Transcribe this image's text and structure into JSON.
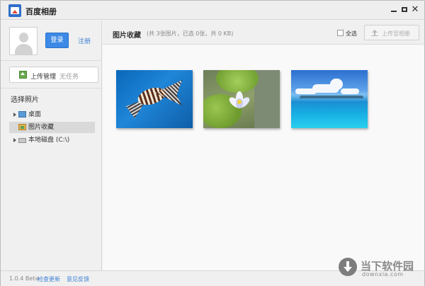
{
  "window": {
    "title": "百度相册"
  },
  "account": {
    "login_label": "登录",
    "register_label": "注册"
  },
  "upload_manager": {
    "label": "上传管理",
    "status": "无任务"
  },
  "sidebar": {
    "section_title": "选择照片",
    "tree": [
      {
        "label": "桌面",
        "icon": "desktop-icon",
        "selected": false,
        "expandable": true
      },
      {
        "label": "图片收藏",
        "icon": "photos-folder-icon",
        "selected": true,
        "expandable": false
      },
      {
        "label": "本地磁盘 (C:\\)",
        "icon": "disk-icon",
        "selected": false,
        "expandable": true
      }
    ]
  },
  "main": {
    "title": "图片收藏",
    "stats": "(共 3张图片，已选 0张，共 0 KB)",
    "select_all_label": "全选",
    "upload_button_label": "上传至相册",
    "photos": [
      {
        "name": "lionfish-photo"
      },
      {
        "name": "water-lily-photo"
      },
      {
        "name": "sea-photo"
      }
    ]
  },
  "footer": {
    "version": "1.0.4 Beta",
    "check_update": "检查更新",
    "feedback": "意见反馈"
  },
  "watermark": {
    "text": "当下软件园",
    "sub": "downxia.com"
  },
  "colors": {
    "accent": "#3d8ae6",
    "link": "#3e7fd5",
    "sidebar_bg": "#eff0ef",
    "main_bg": "#f9f9f9"
  }
}
